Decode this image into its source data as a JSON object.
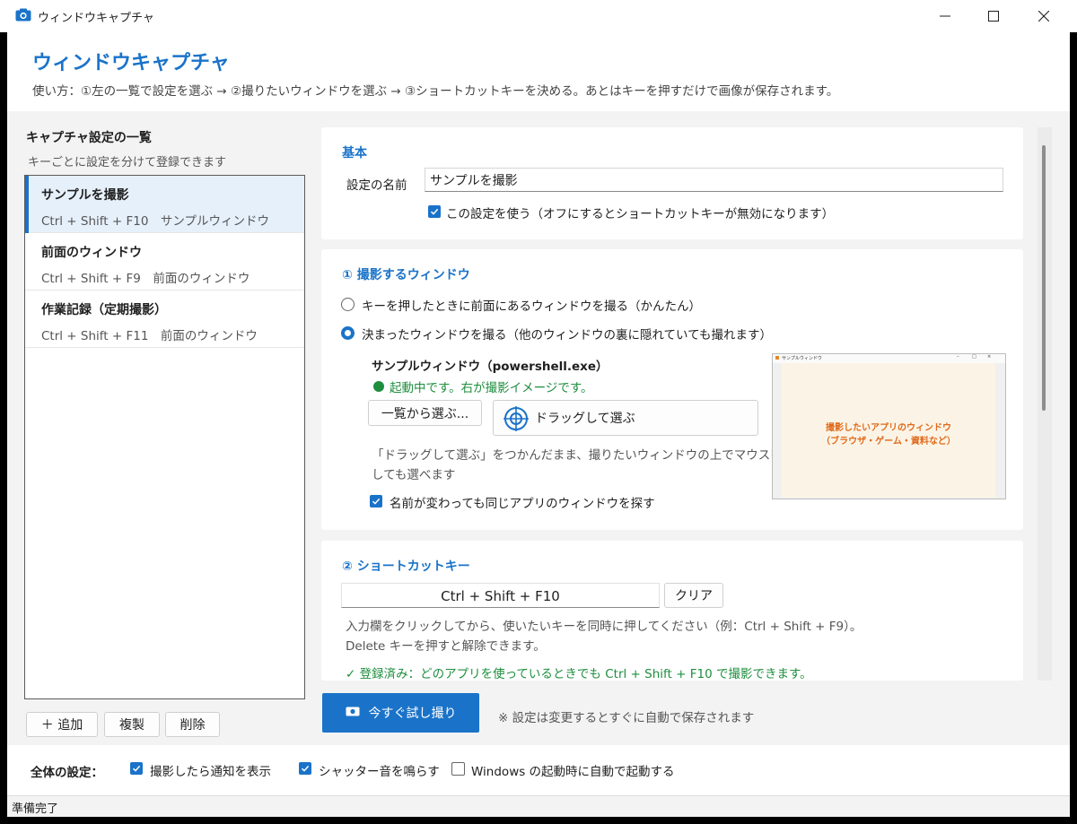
{
  "window": {
    "title": "ウィンドウキャプチャ"
  },
  "header": {
    "title": "ウィンドウキャプチャ",
    "usage": "使い方：①左の一覧で設定を選ぶ → ②撮りたいウィンドウを選ぶ → ③ショートカットキーを決める。あとはキーを押すだけで画像が保存されます。"
  },
  "left": {
    "title": "キャプチャ設定の一覧",
    "subtitle": "キーごとに設定を分けて登録できます",
    "items": [
      {
        "name": "サンプルを撮影",
        "sub": "Ctrl + Shift + F10　サンプルウィンドウ",
        "selected": true
      },
      {
        "name": "前面のウィンドウ",
        "sub": "Ctrl + Shift + F9　前面のウィンドウ",
        "selected": false
      },
      {
        "name": "作業記録（定期撮影）",
        "sub": "Ctrl + Shift + F11　前面のウィンドウ",
        "selected": false
      }
    ],
    "add_label": "＋ 追加",
    "copy_label": "複製",
    "delete_label": "削除"
  },
  "basic": {
    "title": "基本",
    "name_label": "設定の名前",
    "name_value": "サンプルを撮影",
    "enable_label": "この設定を使う（オフにするとショートカットキーが無効になります）"
  },
  "target": {
    "title": "① 撮影するウィンドウ",
    "option_front": "キーを押したときに前面にあるウィンドウを撮る（かんたん）",
    "option_fixed": "決まったウィンドウを撮る（他のウィンドウの裏に隠れていても撮れます）",
    "window_name": "サンプルウィンドウ（powershell.exe）",
    "running_status": "起動中です。右が撮影イメージです。",
    "pick_from_list": "一覧から選ぶ...",
    "drag_pick": "ドラッグして選ぶ",
    "drag_hint_1": "「ドラッグして選ぶ」をつかんだまま、撮りたいウィンドウの上でマウスを離",
    "drag_hint_2": "しても選べます",
    "same_app_label": "名前が変わっても同じアプリのウィンドウを探す",
    "preview_title": "サンプルウィンドウ",
    "preview_line1": "撮影したいアプリのウィンドウ",
    "preview_line2": "（ブラウザ・ゲーム・資料など）"
  },
  "hotkey": {
    "title": "② ショートカットキー",
    "value": "Ctrl + Shift + F10",
    "clear_label": "クリア",
    "hint_1": "入力欄をクリックしてから、使いたいキーを同時に押してください（例：Ctrl + Shift + F9）。",
    "hint_2": "Delete キーを押すと解除できます。",
    "registered": "✓ 登録済み：どのアプリを使っているときでも Ctrl + Shift + F10 で撮影できます。"
  },
  "actions": {
    "capture_now": "今すぐ試し撮り",
    "autosave_note": "※ 設定は変更するとすぐに自動で保存されます"
  },
  "global": {
    "label": "全体の設定：",
    "notify_label": "撮影したら通知を表示",
    "shutter_label": "シャッター音を鳴らす",
    "startup_label": "Windows の起動時に自動で起動する"
  },
  "status": {
    "text": "準備完了"
  },
  "colors": {
    "accent": "#1a73c9",
    "success": "#1e8e3e",
    "preview_text": "#e06a1b"
  }
}
